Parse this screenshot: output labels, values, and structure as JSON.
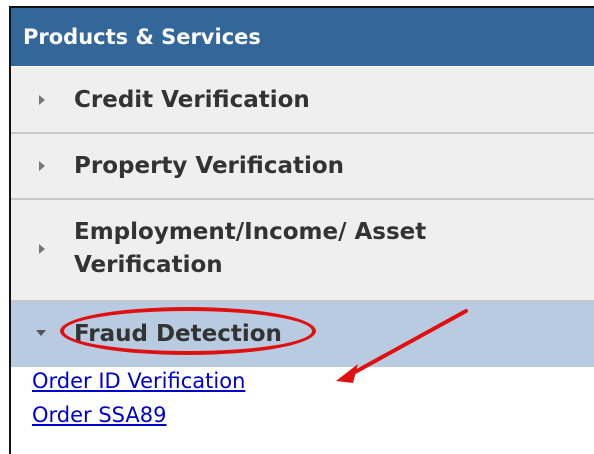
{
  "panel": {
    "header_title": "Products & Services"
  },
  "menu": {
    "items": [
      {
        "label": "Credit Verification",
        "expanded": false
      },
      {
        "label": "Property Verification",
        "expanded": false
      },
      {
        "label": "Employment/Income/ Asset Verification",
        "expanded": false
      },
      {
        "label": "Fraud Detection",
        "expanded": true
      }
    ]
  },
  "submenu": {
    "links": [
      {
        "label": "Order ID Verification"
      },
      {
        "label": "Order SSA89"
      }
    ]
  },
  "annotation": {
    "color": "#e01010"
  },
  "colors": {
    "header_bg": "#336699",
    "active_bg": "#b9cbe0",
    "item_bg": "#efefef",
    "link": "#0000cc"
  }
}
